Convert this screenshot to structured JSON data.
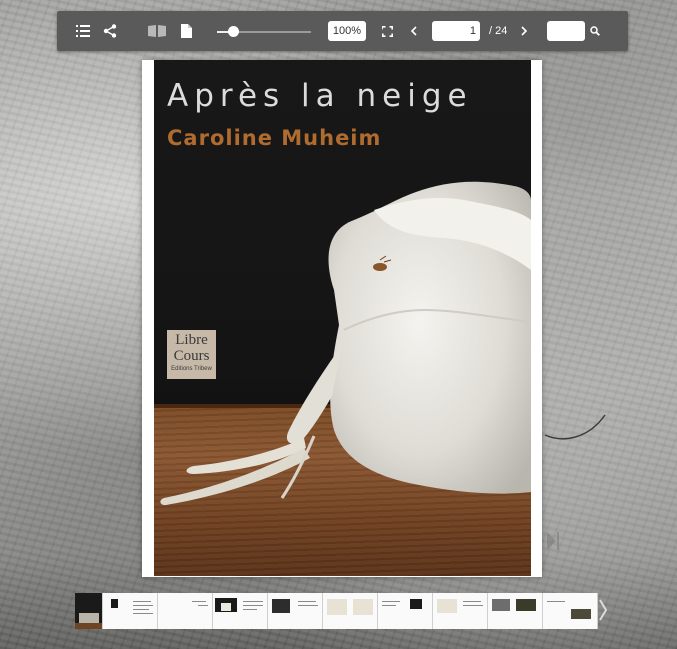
{
  "toolbar": {
    "zoom_label": "100%",
    "zoom_level_fraction": 0.17,
    "current_page": "1",
    "page_total": "/ 24",
    "icons": [
      "list-icon",
      "share-icon",
      "double-page-icon",
      "single-page-icon",
      "fullscreen-icon",
      "chevron-left-icon",
      "chevron-right-icon",
      "search-icon"
    ]
  },
  "cover": {
    "title": "Après la neige",
    "author": "Caroline Muheim",
    "publisher_line1": "Libre",
    "publisher_line2": "Cours",
    "publisher_line3": "Editions Tribew"
  },
  "colors": {
    "toolbar_bg": "#5a5a5a",
    "author_color": "#b06b2e",
    "title_color": "#dcdcdc"
  },
  "thumbnails": {
    "count": 10
  }
}
